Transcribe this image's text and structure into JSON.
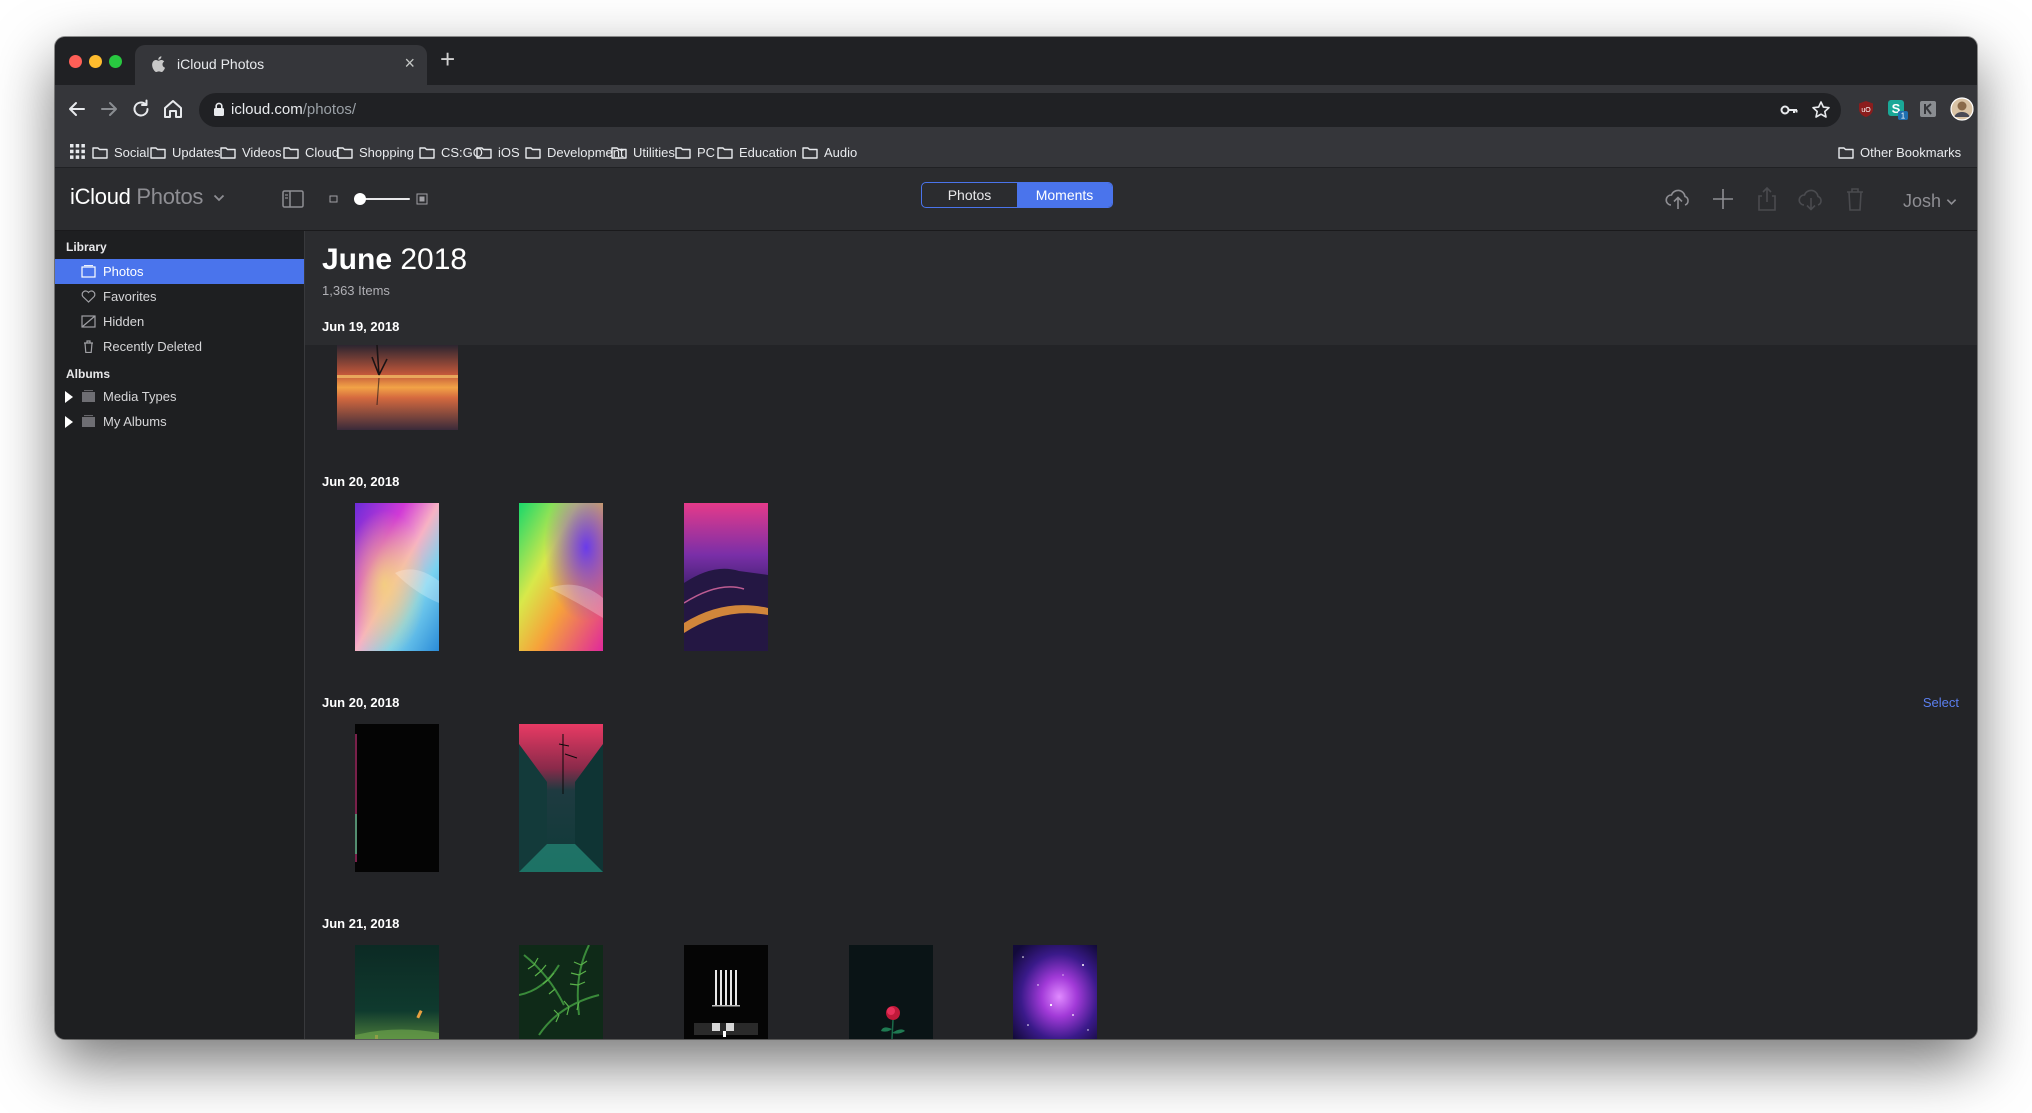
{
  "browser": {
    "tab_title": "iCloud Photos",
    "new_tab_symbol": "+",
    "close_symbol": "×",
    "url_domain": "icloud.com",
    "url_path": "/photos/",
    "ext_badge": "1"
  },
  "bookmarks": {
    "items": [
      "Social",
      "Updates",
      "Videos",
      "Cloud",
      "Shopping",
      "CS:GO",
      "iOS",
      "Development",
      "Utilities",
      "PC",
      "Education",
      "Audio"
    ],
    "other": "Other Bookmarks"
  },
  "app": {
    "brand_main": "iCloud",
    "brand_sub": "Photos",
    "segments": {
      "photos": "Photos",
      "moments": "Moments",
      "selected": "Moments"
    },
    "user": "Josh",
    "accent": "#4a74ec"
  },
  "sidebar": {
    "library_heading": "Library",
    "library_items": [
      "Photos",
      "Favorites",
      "Hidden",
      "Recently Deleted"
    ],
    "albums_heading": "Albums",
    "album_items": [
      "Media Types",
      "My Albums"
    ]
  },
  "content": {
    "month_name": "June",
    "month_year": "2018",
    "item_count": "1,363 Items",
    "select_label": "Select",
    "moments": [
      {
        "date": "Jun 19, 2018",
        "photos": [
          "sunset-lake"
        ]
      },
      {
        "date": "Jun 20, 2018",
        "photos": [
          "rainbow-gradient",
          "neon-gradient",
          "purple-dunes"
        ]
      },
      {
        "date": "Jun 20, 2018",
        "photos": [
          "black-frame",
          "alley-red-sky"
        ]
      },
      {
        "date": "Jun 21, 2018",
        "photos": [
          "green-field",
          "fern-leaves",
          "building-windows",
          "red-rose",
          "galaxy"
        ]
      }
    ]
  }
}
